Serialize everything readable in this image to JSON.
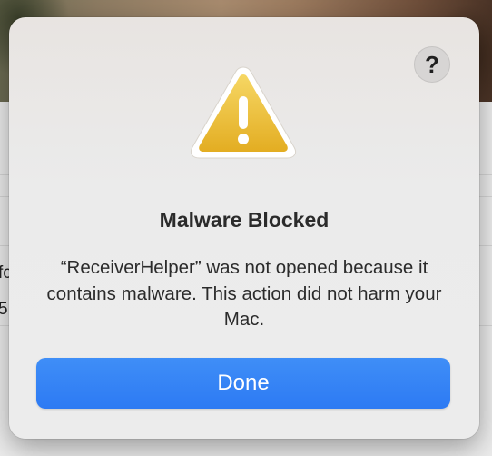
{
  "dialog": {
    "title": "Malware Blocked",
    "message": "“ReceiverHelper” was not opened because it contains malware. This action did not harm your Mac.",
    "help_label": "?",
    "done_label": "Done",
    "icon": "warning-triangle-icon",
    "accent_color": "#3282f6",
    "warning_color": "#f0c43a"
  },
  "background": {
    "partial_texts": [
      "fc",
      "5"
    ]
  }
}
